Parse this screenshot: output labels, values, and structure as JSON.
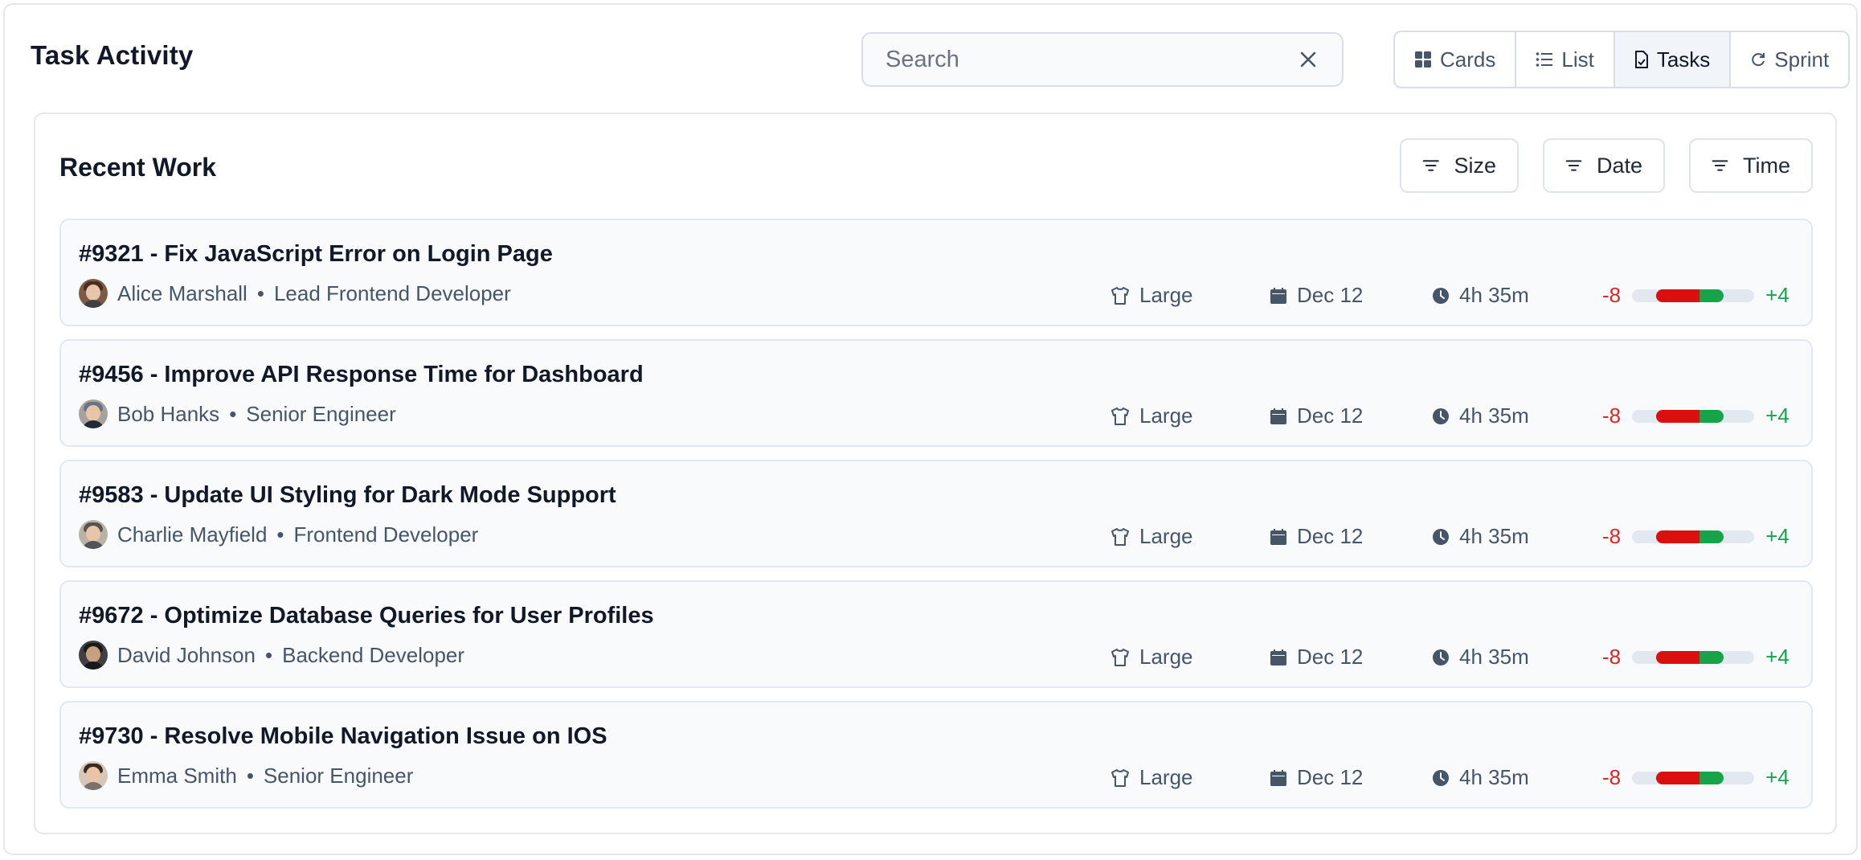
{
  "header": {
    "title": "Task Activity",
    "search_placeholder": "Search",
    "views": [
      {
        "label": "Cards",
        "icon": "grid-icon",
        "active": false
      },
      {
        "label": "List",
        "icon": "list-icon",
        "active": false
      },
      {
        "label": "Tasks",
        "icon": "document-icon",
        "active": true
      },
      {
        "label": "Sprint",
        "icon": "refresh-icon",
        "active": false
      }
    ]
  },
  "panel": {
    "title": "Recent Work",
    "filters": [
      {
        "label": "Size",
        "icon": "filter-icon"
      },
      {
        "label": "Date",
        "icon": "filter-icon"
      },
      {
        "label": "Time",
        "icon": "filter-icon"
      }
    ]
  },
  "colors": {
    "negative": "#dc2626",
    "positive": "#16a34a",
    "bar_red": "#dc0f0f",
    "bar_green": "#16a34a",
    "row_bg": "#f8fafc"
  },
  "tasks": [
    {
      "title": "#9321 - Fix JavaScript Error on Login Page",
      "assignee": "Alice Marshall",
      "role": "Lead Frontend Developer",
      "size": "Large",
      "date": "Dec 12",
      "time": "4h 35m",
      "minus": "-8",
      "plus": "+4"
    },
    {
      "title": "#9456 - Improve API Response Time for Dashboard",
      "assignee": "Bob Hanks",
      "role": "Senior Engineer",
      "size": "Large",
      "date": "Dec 12",
      "time": "4h 35m",
      "minus": "-8",
      "plus": "+4"
    },
    {
      "title": "#9583 - Update UI Styling for Dark Mode Support",
      "assignee": "Charlie Mayfield",
      "role": "Frontend Developer",
      "size": "Large",
      "date": "Dec 12",
      "time": "4h 35m",
      "minus": "-8",
      "plus": "+4"
    },
    {
      "title": "#9672 - Optimize Database Queries for User Profiles",
      "assignee": "David Johnson",
      "role": "Backend Developer",
      "size": "Large",
      "date": "Dec 12",
      "time": "4h 35m",
      "minus": "-8",
      "plus": "+4"
    },
    {
      "title": "#9730 - Resolve Mobile Navigation Issue on IOS",
      "assignee": "Emma Smith",
      "role": "Senior Engineer",
      "size": "Large",
      "date": "Dec 12",
      "time": "4h 35m",
      "minus": "-8",
      "plus": "+4"
    }
  ]
}
